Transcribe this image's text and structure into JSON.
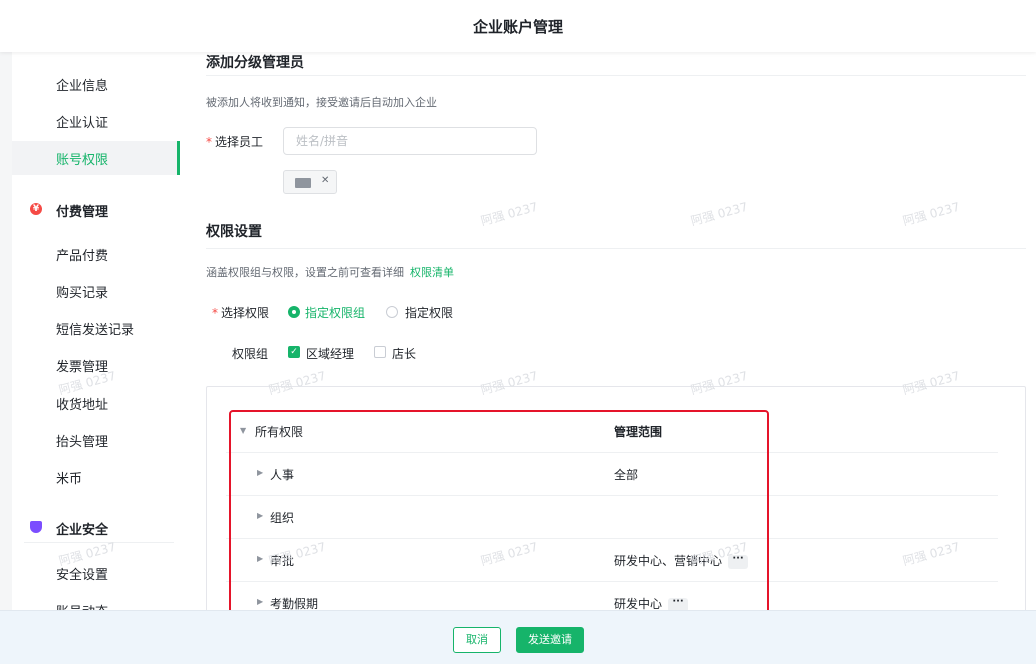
{
  "header": {
    "title": "企业账户管理"
  },
  "sidebar": {
    "items": [
      {
        "label": "企业信息"
      },
      {
        "label": "企业认证"
      },
      {
        "label": "账号权限"
      }
    ],
    "billing": {
      "title": "付费管理",
      "icon": "yen-circle-icon",
      "items": [
        {
          "label": "产品付费"
        },
        {
          "label": "购买记录"
        },
        {
          "label": "短信发送记录"
        },
        {
          "label": "发票管理"
        },
        {
          "label": "收货地址"
        },
        {
          "label": "抬头管理"
        },
        {
          "label": "米币"
        }
      ]
    },
    "security": {
      "title": "企业安全",
      "icon": "shield-icon",
      "items": [
        {
          "label": "安全设置"
        },
        {
          "label": "账号动态"
        }
      ]
    }
  },
  "form": {
    "title": "添加分级管理员",
    "hint": "被添加人将收到通知，接受邀请后自动加入企业",
    "employee_label": "选择员工",
    "employee_placeholder": "姓名/拼音",
    "permissions": {
      "title": "权限设置",
      "hint": "涵盖权限组与权限，设置之前可查看详细",
      "hint_link": "权限清单",
      "select_label": "选择权限",
      "radio_options": [
        {
          "label": "指定权限组",
          "selected": true
        },
        {
          "label": "指定权限",
          "selected": false
        }
      ],
      "group_label": "权限组",
      "groups": [
        {
          "label": "区域经理",
          "checked": true
        },
        {
          "label": "店长",
          "checked": false
        }
      ],
      "tree": {
        "root_label": "所有权限",
        "scope_header": "管理范围",
        "rows": [
          {
            "name": "人事",
            "scope": "全部",
            "more": ""
          },
          {
            "name": "组织",
            "scope": "",
            "more": ""
          },
          {
            "name": "审批",
            "scope": "研发中心、营销中心",
            "more": "···"
          },
          {
            "name": "考勤假期",
            "scope": "研发中心",
            "more": "···"
          }
        ]
      }
    }
  },
  "watermark": "阿强 0237",
  "footer": {
    "cancel_label": "取消",
    "send_label": "发送邀请"
  },
  "colors": {
    "accent": "#16b46a",
    "highlight": "#e5142a",
    "security_icon": "#7b4dff",
    "billing_icon": "#f54a45"
  }
}
